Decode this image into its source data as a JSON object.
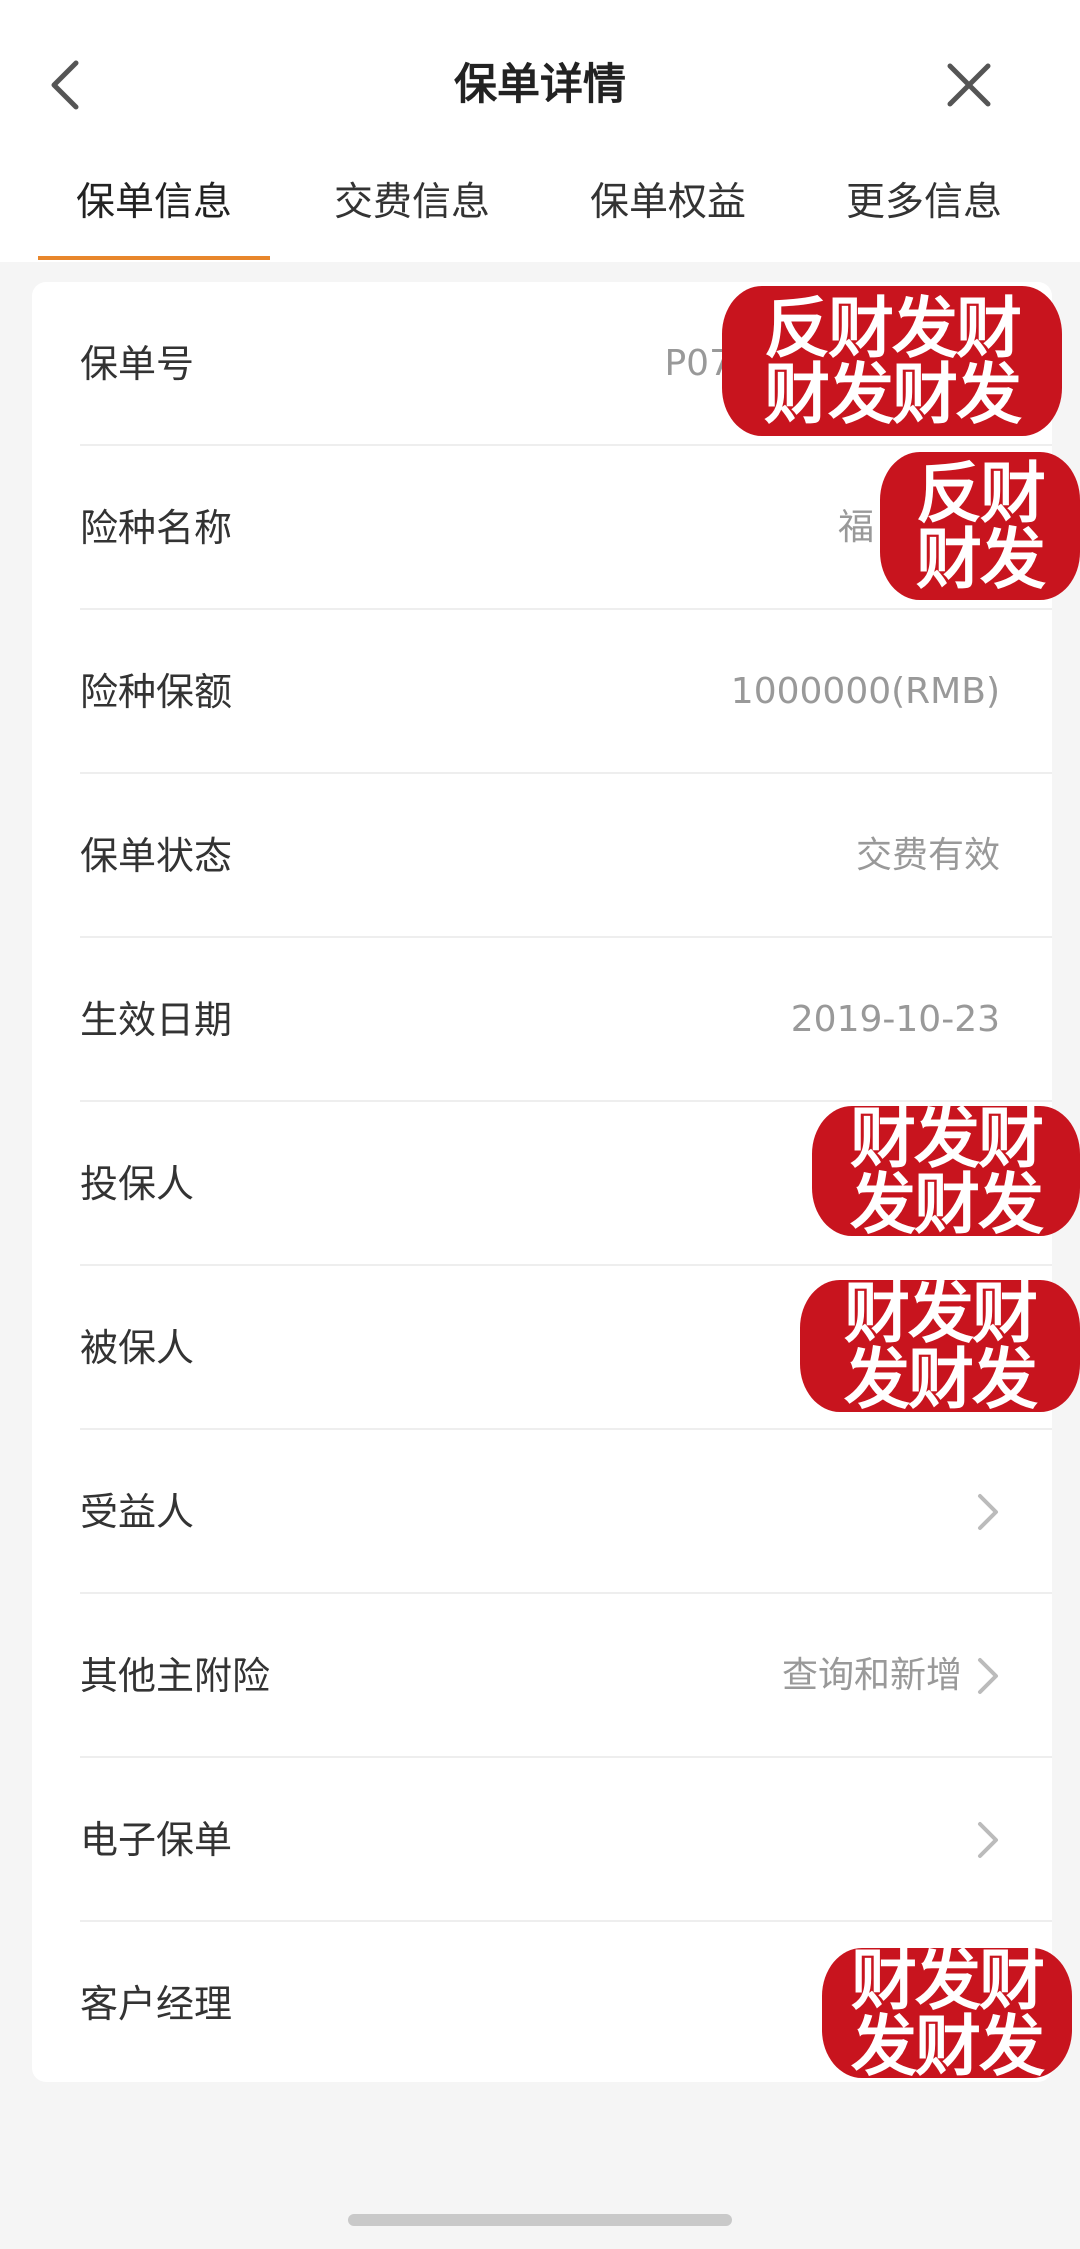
{
  "header": {
    "title": "保单详情",
    "back_icon": "chevron-left-icon",
    "close_icon": "close-icon"
  },
  "tabs": [
    {
      "label": "保单信息",
      "active": true
    },
    {
      "label": "交费信息",
      "active": false
    },
    {
      "label": "保单权益",
      "active": false
    },
    {
      "label": "更多信息",
      "active": false
    }
  ],
  "colors": {
    "accent": "#e8862b",
    "stamp": "#c8141e",
    "value_text": "#999999"
  },
  "rows": [
    {
      "label": "保单号",
      "value": "P07"
    },
    {
      "label": "险种名称",
      "value": "福"
    },
    {
      "label": "险种保额",
      "value": "1000000(RMB)"
    },
    {
      "label": "保单状态",
      "value": "交费有效"
    },
    {
      "label": "生效日期",
      "value": "2019-10-23"
    },
    {
      "label": "投保人",
      "value": ""
    },
    {
      "label": "被保人",
      "value": ""
    },
    {
      "label": "受益人",
      "value": ""
    },
    {
      "label": "其他主附险",
      "value": "查询和新增"
    },
    {
      "label": "电子保单",
      "value": ""
    },
    {
      "label": "客户经理",
      "value": ""
    }
  ],
  "stamps": {
    "a": "反财发财\n财发财发",
    "b": "反财\n财发",
    "c": "财发财\n发财发"
  }
}
